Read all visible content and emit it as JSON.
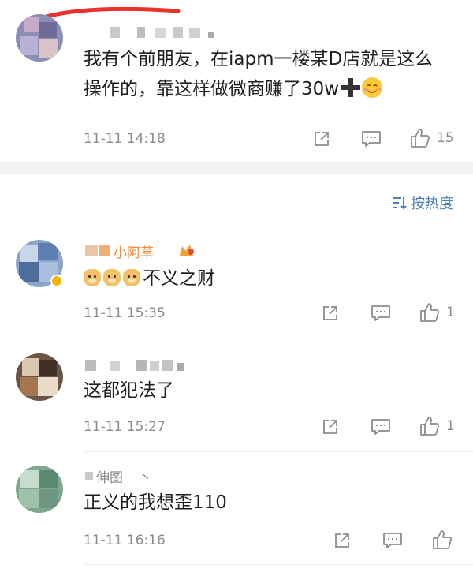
{
  "top_comment": {
    "text_line1": "我有个前朋友，在iapm一楼某D店就是这么",
    "text_line2": "操作的，靠这样做微商赚了30w",
    "timestamp": "11-11 14:18",
    "like_count": "15"
  },
  "sort": {
    "label": "按热度"
  },
  "replies": [
    {
      "name": "小阿草",
      "text": "不义之财",
      "timestamp": "11-11 15:35",
      "like_count": "1"
    },
    {
      "text": "这都犯法了",
      "timestamp": "11-11 15:27",
      "like_count": "1"
    },
    {
      "name": "伸图",
      "text": "正义的我想歪110",
      "timestamp": "11-11 16:16",
      "like_count": ""
    }
  ],
  "colors": {
    "accent_blue": "#4a7fb8",
    "muted_gray": "#8c8c8c",
    "scribble_red": "#e8332c",
    "verified_gold": "#f4b400"
  },
  "icons": {
    "share": "share-icon",
    "comment": "comment-icon",
    "like": "thumbs-up-icon",
    "sort": "sort-icon"
  }
}
